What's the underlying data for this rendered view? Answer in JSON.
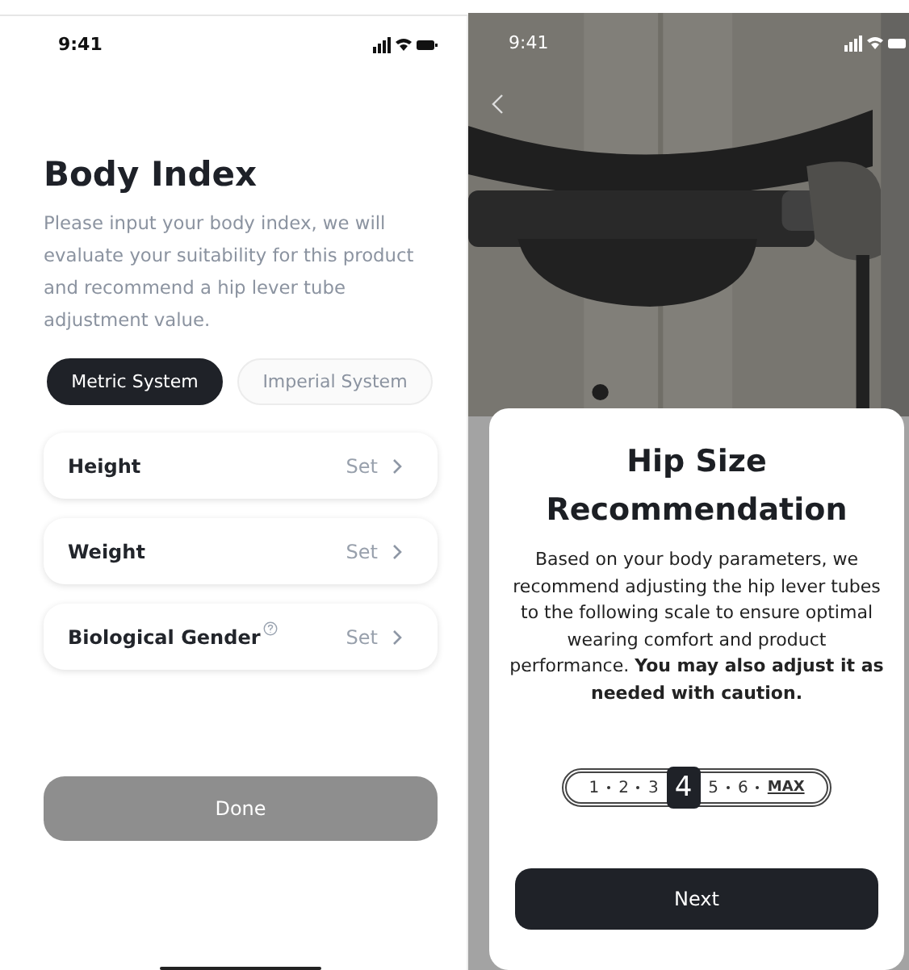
{
  "body_index": {
    "status_time": "9:41",
    "title": "Body Index",
    "description": "Please input your body index, we will evaluate your suitability for this product and recommend a hip lever tube adjustment value.",
    "unit_tabs": [
      {
        "label": "Metric System",
        "selected": true
      },
      {
        "label": "Imperial System",
        "selected": false
      }
    ],
    "fields": [
      {
        "label": "Height",
        "value": "Set",
        "help": false
      },
      {
        "label": "Weight",
        "value": "Set",
        "help": false
      },
      {
        "label": "Biological Gender",
        "value": "Set",
        "help": true
      }
    ],
    "done_button": {
      "label": "Done",
      "disabled": true
    }
  },
  "hip_size_dialog": {
    "status_time": "9:41",
    "title": "Hip Size Recommendation",
    "message": "Based on your body parameters, we recommend adjusting the hip lever tubes to the following scale to ensure optimal wearing comfort and product performance. **You may also adjust it as needed with caution.**",
    "scale": [
      {
        "label": "1",
        "selected": false
      },
      {
        "label": "2",
        "selected": false
      },
      {
        "label": "3",
        "selected": false
      },
      {
        "label": "4",
        "selected": true
      },
      {
        "label": "5",
        "selected": false
      },
      {
        "label": "6",
        "selected": false
      },
      {
        "label": "MAX",
        "selected": false
      }
    ],
    "next_button": {
      "label": "Next"
    }
  }
}
